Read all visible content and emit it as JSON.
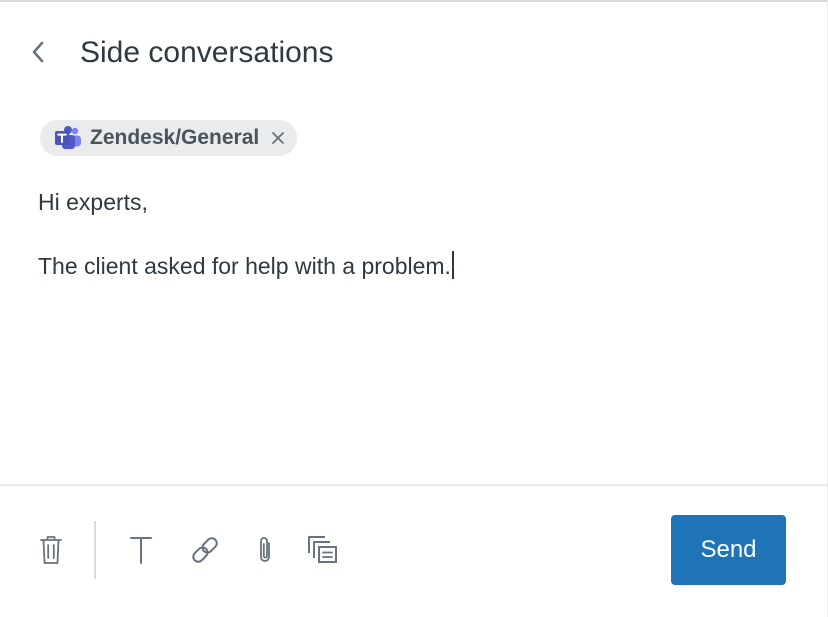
{
  "header": {
    "title": "Side conversations"
  },
  "recipients": [
    {
      "label": "Zendesk/General",
      "icon": "microsoft-teams-icon"
    }
  ],
  "message": {
    "lines": [
      "Hi experts,",
      "The client asked for help with a problem."
    ]
  },
  "toolbar": {
    "icons": [
      "trash-icon",
      "text-format-icon",
      "link-icon",
      "attachment-icon",
      "macro-icon"
    ],
    "send_label": "Send"
  },
  "colors": {
    "primary": "#1f73b7",
    "text": "#2f3941",
    "chip_bg": "#e9ebed",
    "icon": "#68737d",
    "teams_purple": "#5059c9"
  }
}
